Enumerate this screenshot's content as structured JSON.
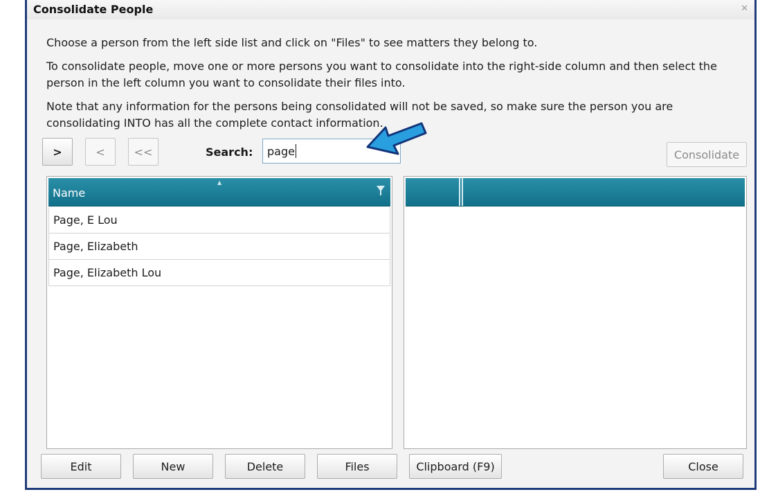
{
  "window": {
    "title": "Consolidate People",
    "close_glyph": "✕"
  },
  "instructions": [
    "Choose a person from the left side list and click on \"Files\" to see matters they belong to.",
    "To consolidate people, move one or more persons you want to consolidate into the right-side column and then select the person in the left column you want to consolidate their files into.",
    "Note that any information for the persons being consolidated will not be saved, so make sure the person you are consolidating INTO has all the complete contact information."
  ],
  "toolbar": {
    "move_right": ">",
    "move_left": "<",
    "move_all_left": "<<",
    "search_label": "Search:",
    "search_value": "page",
    "consolidate": "Consolidate"
  },
  "left_grid": {
    "column_header": "Name",
    "rows": [
      "Page, E Lou",
      "Page, Elizabeth",
      "Page, Elizabeth Lou"
    ]
  },
  "bottom_buttons": {
    "edit": "Edit",
    "new": "New",
    "delete": "Delete",
    "files": "Files",
    "clipboard": "Clipboard (F9)",
    "close": "Close"
  },
  "colors": {
    "header": "#12708a",
    "window_border": "#1f3b7a",
    "annotation_arrow": "#2a9fe0"
  }
}
